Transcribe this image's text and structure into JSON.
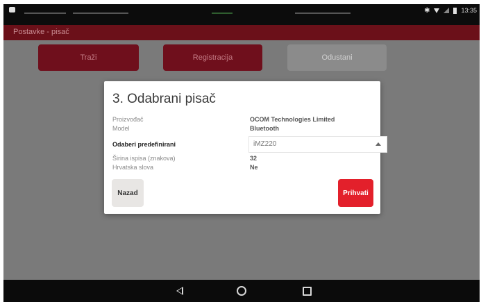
{
  "statusbar": {
    "time": "13:35"
  },
  "appbar": {
    "title": "Postavke - pisač"
  },
  "background_buttons": {
    "search": "Traži",
    "register": "Registracija",
    "cancel": "Odustani"
  },
  "dialog": {
    "title": "3. Odabrani pisač",
    "rows": {
      "manufacturer": {
        "label": "Proizvođač",
        "value": "OCOM Technologies Limited"
      },
      "model": {
        "label": "Model",
        "value": "Bluetooth"
      },
      "predefined": {
        "label": "Odaberi predefinirani",
        "value": "iMZ220"
      },
      "width": {
        "label": "Širina ispisa (znakova)",
        "value": "32"
      },
      "croatian": {
        "label": "Hrvatska slova",
        "value": "Ne"
      }
    },
    "back_label": "Nazad",
    "accept_label": "Prihvati"
  },
  "colors": {
    "accent": "#e3202b",
    "appbar": "#6b1019",
    "overlay": "#7a7a7a"
  }
}
